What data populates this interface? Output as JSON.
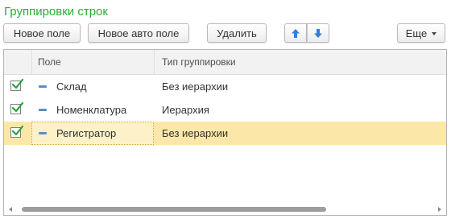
{
  "form": {
    "title": "Группировки строк"
  },
  "toolbar": {
    "new_label": "Новое поле",
    "new_auto_label": "Новое авто поле",
    "delete_label": "Удалить",
    "move_up_icon": "arrow-up-icon",
    "move_down_icon": "arrow-down-icon",
    "more_label": "Еще"
  },
  "colors": {
    "title": "#2eaa3a",
    "arrow": "#2f7fd6",
    "check": "#24a33a",
    "selected_row": "#fbe7a7"
  },
  "grid": {
    "columns": [
      "Поле",
      "Тип группировки"
    ],
    "rows": [
      {
        "checked": true,
        "field": "Склад",
        "type": "Без иерархии",
        "selected": false
      },
      {
        "checked": true,
        "field": "Номенклатура",
        "type": "Иерархия",
        "selected": false
      },
      {
        "checked": true,
        "field": "Регистратор",
        "type": "Без иерархии",
        "selected": true
      }
    ]
  }
}
